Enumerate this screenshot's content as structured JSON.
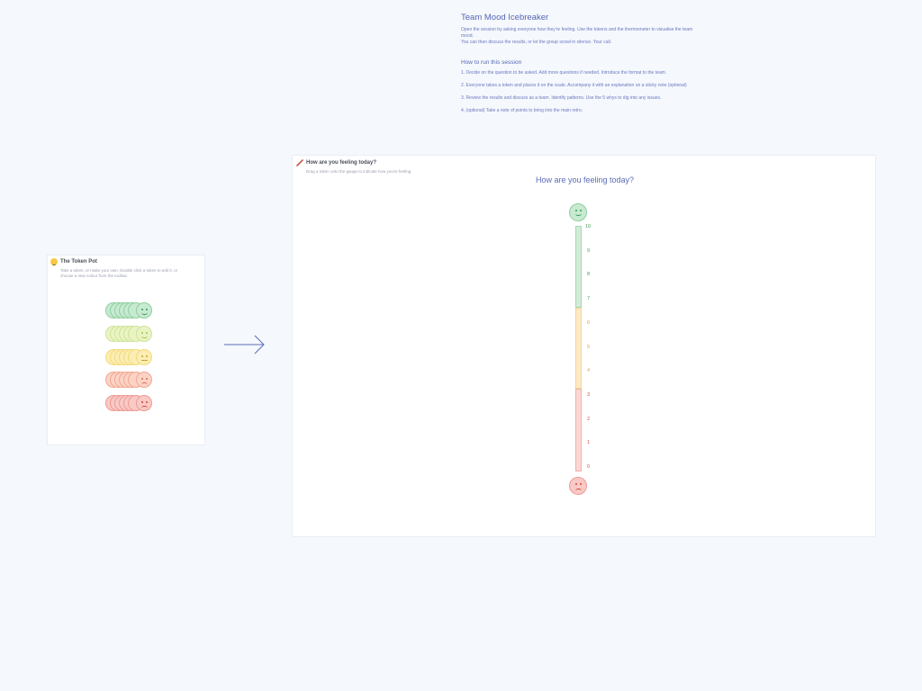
{
  "intro": {
    "title": "Team Mood Icebreaker",
    "lines": [
      "Open the session by asking everyone how they're feeling. Use the tokens and the thermometer to visualise the team mood.",
      "You can then discuss the results, or let the group scowl in silence. Your call."
    ],
    "howto_title": "How to run this session",
    "steps": [
      "1.    Decide on the question to be asked. Add more questions if needed. Introduce the format to the team.",
      "2. Everyone takes a token and places it on the scale. Accompany it with an explanation on a sticky note (optional)",
      "3. Review the results and discuss as a team. Identify patterns. Use the 5 whys to dig into any issues.",
      "4. (optional) Take a note of points to bring into the main retro."
    ]
  },
  "token_pot": {
    "title": "The Token Pot",
    "description": "Take a token, or make your own. Double click a token to edit it, or choose a new colour from the toolbar.",
    "rows": [
      {
        "mood": "very-happy",
        "fill": "#c7ead1",
        "stroke": "#8fcf9f",
        "feature": "#3d9a57"
      },
      {
        "mood": "happy",
        "fill": "#eaf4c3",
        "stroke": "#cfe39a",
        "feature": "#a6c04a"
      },
      {
        "mood": "neutral",
        "fill": "#fbeeb4",
        "stroke": "#f4d97a",
        "feature": "#c8a12a"
      },
      {
        "mood": "sad",
        "fill": "#fbd3c6",
        "stroke": "#f0a88f",
        "feature": "#d46a4a"
      },
      {
        "mood": "angry",
        "fill": "#f9c9c5",
        "stroke": "#ee9a94",
        "feature": "#d0443c"
      }
    ]
  },
  "gauge": {
    "title": "How are you feeling today?",
    "description": "Drag a token onto the gauge to indicate how you're feeling.",
    "question": "How are you feeling today?",
    "ticks": [
      "10",
      "9",
      "8",
      "7",
      "6",
      "5",
      "4",
      "3",
      "2",
      "1",
      "0"
    ],
    "colors": {
      "green": "#4a9a5a",
      "orange": "#e8a040",
      "red": "#d85040",
      "green_fill": "#d3ecd8",
      "orange_fill": "#fdeac6",
      "red_fill": "#fbd8d4"
    }
  }
}
